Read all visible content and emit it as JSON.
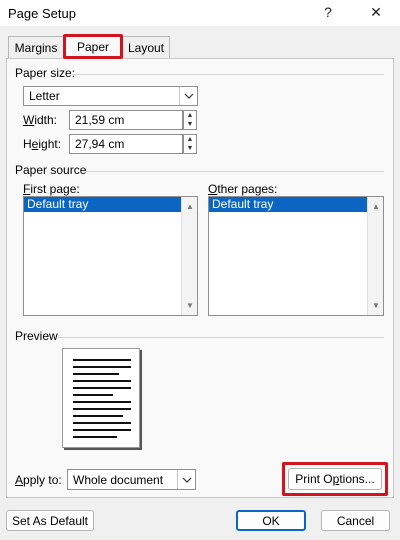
{
  "window": {
    "title": "Page Setup",
    "help_glyph": "?",
    "close_glyph": "✕"
  },
  "tabs": [
    {
      "label": "Margins"
    },
    {
      "label": "Paper"
    },
    {
      "label": "Layout"
    }
  ],
  "paper_size": {
    "group_label": "Paper size:",
    "selected": "Letter",
    "width_label": "Width:",
    "width_value": "21,59 cm",
    "height_label": "Height:",
    "height_value": "27,94 cm"
  },
  "paper_source": {
    "group_label": "Paper source",
    "first_page_label": "First page:",
    "first_page_items": [
      "Default tray"
    ],
    "other_pages_label": "Other pages:",
    "other_pages_items": [
      "Default tray"
    ]
  },
  "preview": {
    "group_label": "Preview"
  },
  "apply_to": {
    "label": "Apply to:",
    "selected": "Whole document"
  },
  "buttons": {
    "print_options": "Print Options...",
    "set_as_default": "Set As Default",
    "ok": "OK",
    "cancel": "Cancel"
  },
  "colors": {
    "selection": "#0a66c2",
    "highlight": "#d0151f"
  }
}
